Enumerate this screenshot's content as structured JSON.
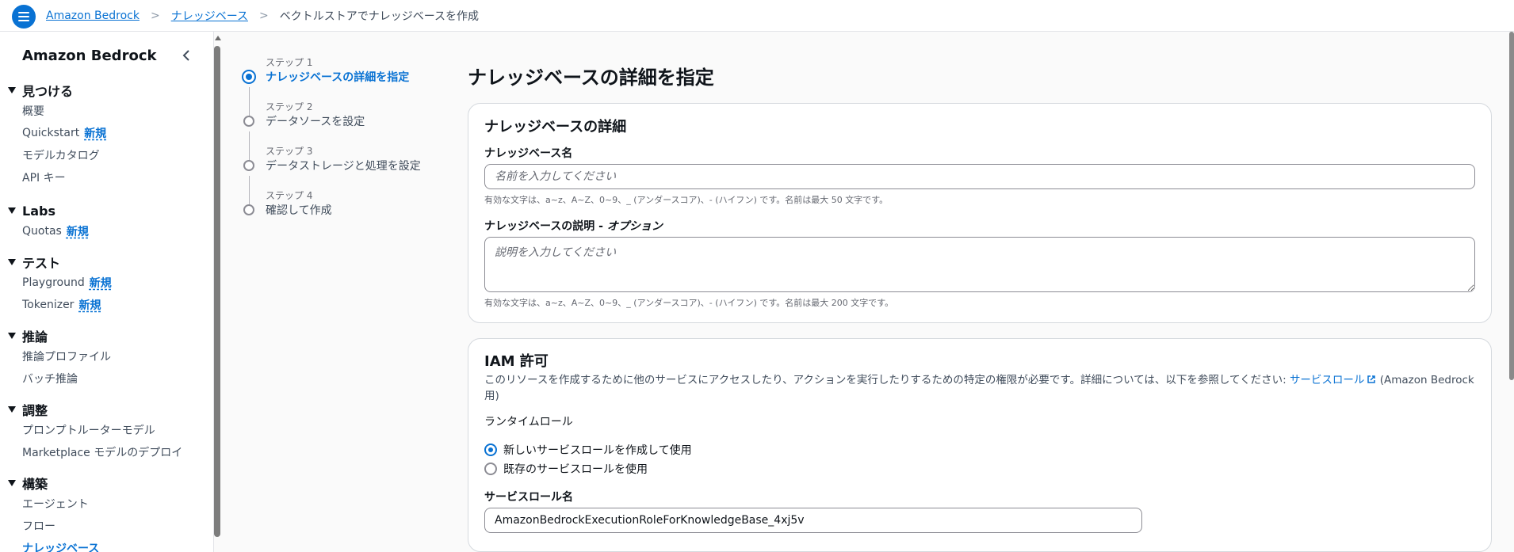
{
  "header": {
    "breadcrumbs": [
      "Amazon Bedrock",
      "ナレッジベース"
    ],
    "current": "ベクトルストアでナレッジベースを作成"
  },
  "sidebar": {
    "title": "Amazon Bedrock",
    "badge": "新規",
    "sections": [
      {
        "heading": "見つける",
        "items": [
          "概要",
          "Quickstart",
          "モデルカタログ",
          "API キー"
        ]
      },
      {
        "heading": "Labs",
        "items": [
          "Quotas"
        ]
      },
      {
        "heading": "テスト",
        "items": [
          "Playground",
          "Tokenizer"
        ]
      },
      {
        "heading": "推論",
        "items": [
          "推論プロファイル",
          "バッチ推論"
        ]
      },
      {
        "heading": "調整",
        "items": [
          "プロンプトルーターモデル",
          "Marketplace モデルのデプロイ"
        ]
      },
      {
        "heading": "構築",
        "items": [
          "エージェント",
          "フロー",
          "ナレッジベース"
        ]
      }
    ]
  },
  "steps": [
    {
      "label": "ステップ 1",
      "title": "ナレッジベースの詳細を指定"
    },
    {
      "label": "ステップ 2",
      "title": "データソースを設定"
    },
    {
      "label": "ステップ 3",
      "title": "データストレージと処理を設定"
    },
    {
      "label": "ステップ 4",
      "title": "確認して作成"
    }
  ],
  "main": {
    "page_title": "ナレッジベースの詳細を指定",
    "details": {
      "title": "ナレッジベースの詳細",
      "name_label": "ナレッジベース名",
      "name_placeholder": "名前を入力してください",
      "name_hint": "有効な文字は、a~z、A~Z、0~9、_ (アンダースコア)、- (ハイフン) です。名前は最大 50 文字です。",
      "desc_label": "ナレッジベースの説明 - ",
      "desc_label_opt": "オプション",
      "desc_placeholder": "説明を入力してください",
      "desc_hint": "有効な文字は、a~z、A~Z、0~9、_ (アンダースコア)、- (ハイフン) です。名前は最大 200 文字です。"
    },
    "iam": {
      "title": "IAM 許可",
      "description": "このリソースを作成するために他のサービスにアクセスしたり、アクションを実行したりするための特定の権限が必要です。詳細については、以下を参照してください: ",
      "link": "サービスロール",
      "description_tail": " (Amazon Bedrock 用)",
      "runtime_role_label": "ランタイムロール",
      "option_new": "新しいサービスロールを作成して使用",
      "option_existing": "既存のサービスロールを使用",
      "role_name_label": "サービスロール名",
      "role_name_value": "AmazonBedrockExecutionRoleForKnowledgeBase_4xj5v"
    }
  },
  "colors": {
    "accent": "#0972d3",
    "text": "#0f141a",
    "muted": "#656871"
  }
}
